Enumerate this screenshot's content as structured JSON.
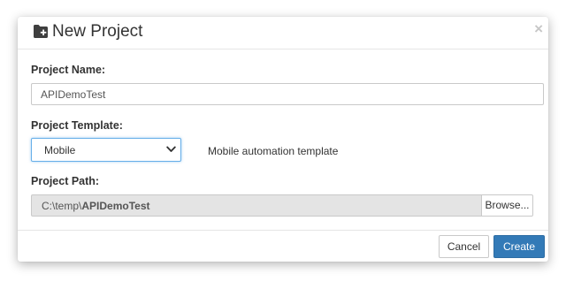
{
  "dialog": {
    "title": "New Project",
    "title_icon": "folder-plus-icon",
    "close_glyph": "×"
  },
  "form": {
    "project_name": {
      "label": "Project Name:",
      "value": "APIDemoTest"
    },
    "project_template": {
      "label": "Project Template:",
      "selected": "Mobile",
      "description": "Mobile automation template"
    },
    "project_path": {
      "label": "Project Path:",
      "prefix": "C:\\temp\\",
      "name": "APIDemoTest",
      "browse_label": "Browse..."
    }
  },
  "footer": {
    "cancel_label": "Cancel",
    "create_label": "Create"
  },
  "colors": {
    "primary": "#337ab7",
    "focus_border": "#66afe9",
    "readonly_bg": "#e4e4e4"
  }
}
